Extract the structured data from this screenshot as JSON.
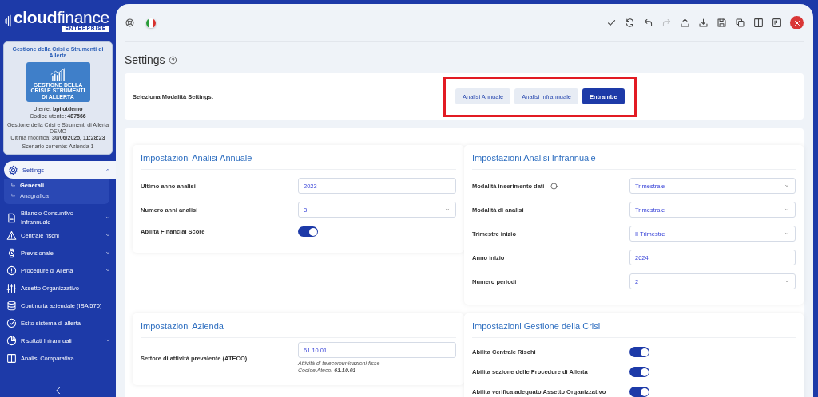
{
  "brand": {
    "name_bold": "cloud",
    "name_light": "finance",
    "edition": "ENTERPRISE"
  },
  "profile_card": {
    "title": "Gestione della Crisi e Strumenti di Allerta",
    "badge_text": "GESTIONE DELLA CRISI E STRUMENTI DI ALLERTA",
    "user": "Utente: **bpilotdemo**",
    "code": "Codice utente: **487566**",
    "product": "Gestione della Crisi e Strumenti di Allerta DEMO",
    "modified": "Ultima modifica: **30/06/2025, 11:28:23**",
    "scenario": "Scenario corrente: Azienda 1"
  },
  "nav": [
    {
      "label": "Settings",
      "kind": "gear",
      "expanded": true,
      "selected": true,
      "children": [
        {
          "label": "Generali",
          "selected": true
        },
        {
          "label": "Anagrafica",
          "selected": false
        }
      ]
    },
    {
      "label": "Bilancio Consuntivo Infrannuale",
      "kind": "document",
      "expanded": false,
      "selected": false
    },
    {
      "label": "Centrale rischi",
      "kind": "warning",
      "expanded": false,
      "selected": false
    },
    {
      "label": "Previsionale",
      "kind": "watch",
      "expanded": false,
      "selected": false
    },
    {
      "label": "Procedure di Allerta",
      "kind": "alert",
      "expanded": false,
      "selected": false
    },
    {
      "label": "Assetto Organizzativo",
      "kind": "sliders",
      "selected": false
    },
    {
      "label": "Continuità aziendale (ISA 570)",
      "kind": "database",
      "selected": false
    },
    {
      "label": "Esito sistema di allerta",
      "kind": "check",
      "selected": false
    },
    {
      "label": "Risultati Infrannuali",
      "kind": "pie",
      "expanded": false,
      "selected": false
    },
    {
      "label": "Analisi Comparativa",
      "kind": "columns",
      "selected": false
    }
  ],
  "toolbar_left": [
    {
      "kind": "lifebuoy"
    },
    {
      "kind": "flag"
    }
  ],
  "toolbar_right": [
    {
      "kind": "check",
      "disabled": false
    },
    {
      "kind": "refresh",
      "disabled": false
    },
    {
      "kind": "undo",
      "disabled": false
    },
    {
      "kind": "redo",
      "disabled": true
    },
    {
      "kind": "upload",
      "disabled": false
    },
    {
      "kind": "download",
      "disabled": false
    },
    {
      "kind": "save",
      "disabled": false
    },
    {
      "kind": "copy",
      "disabled": false
    },
    {
      "kind": "columns",
      "disabled": false
    },
    {
      "kind": "board",
      "disabled": false
    },
    {
      "kind": "close",
      "disabled": false
    }
  ],
  "page_title": "Settings",
  "mode_selector": {
    "label": "Seleziona Modalità Settings:",
    "highlighted": true,
    "options": [
      {
        "label": "Analisi Annuale",
        "selected": false
      },
      {
        "label": "Analisi Infrannuale",
        "selected": false
      },
      {
        "label": "Entrambe",
        "selected": true
      }
    ]
  },
  "sections": [
    {
      "title": "Impostazioni Analisi Annuale",
      "rows": [
        {
          "label": "Ultimo anno analisi",
          "kind": "input",
          "value": "2023"
        },
        {
          "label": "Numero anni analisi",
          "kind": "select",
          "value": "3"
        },
        {
          "label": "Abilita Financial Score",
          "kind": "toggle",
          "on": true
        }
      ]
    },
    {
      "title": "Impostazioni Analisi Infrannuale",
      "rows": [
        {
          "label": "Modalità inserimento dati",
          "kind": "select",
          "value": "Trimestrale",
          "info": true
        },
        {
          "label": "Modalità di analisi",
          "kind": "select",
          "value": "Trimestrale"
        },
        {
          "label": "Trimestre inizio",
          "kind": "select",
          "value": "II Trimestre"
        },
        {
          "label": "Anno inizio",
          "kind": "input",
          "value": "2024"
        },
        {
          "label": "Numero periodi",
          "kind": "select",
          "value": "2"
        }
      ]
    },
    {
      "title": "Impostazioni Azienda",
      "rows": [
        {
          "label": "Settore di attività prevalente (ATECO)",
          "kind": "input",
          "value": "61.10.01",
          "hints": [
            "Attività di telecomunicazioni fisse",
            "Codice Ateco: **61.10.01**"
          ]
        }
      ]
    },
    {
      "title": "Impostazioni Gestione della Crisi",
      "rows": [
        {
          "label": "Abilita Centrale Rischi",
          "kind": "toggle",
          "on": true
        },
        {
          "label": "Abilita sezione delle Procedure di Allerta",
          "kind": "toggle",
          "on": true
        },
        {
          "label": "Abilita verifica adeguato Assetto Organizzativo",
          "kind": "toggle",
          "on": true
        }
      ]
    }
  ]
}
